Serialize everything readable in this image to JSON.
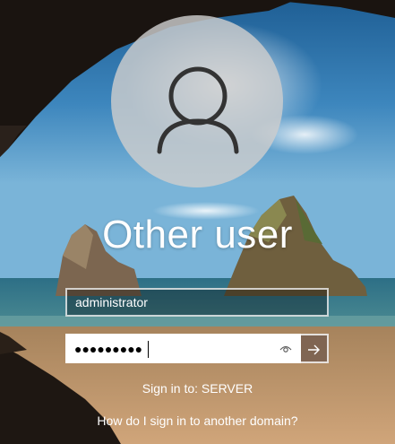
{
  "user": {
    "display_name": "Other user",
    "avatar_icon": "user-silhouette-icon"
  },
  "form": {
    "username_value": "administrator",
    "password_masked": "●●●●●●●●●",
    "reveal_icon": "eye-icon",
    "submit_icon": "arrow-right-icon"
  },
  "signin_target": "Sign in to: SERVER",
  "other_domain_link": "How do I sign in to another domain?",
  "colors": {
    "text": "#ffffff",
    "submit_bg": "#785f50",
    "avatar_bg": "#cdcdcd"
  }
}
